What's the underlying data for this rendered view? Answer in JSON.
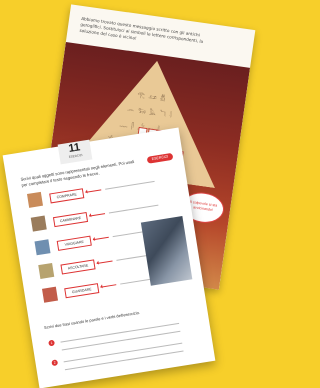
{
  "back_page": {
    "intro": "Abbiamo trovato questo messaggio scritto con gli antichi geroglifici. Sostituisci ai simboli le lettere corrispondenti, la soluzione del caso è vicina!",
    "bubble": "Il colpevole si sta avvicinando!"
  },
  "front_page": {
    "page_number": "11",
    "page_label": "ESERCIZI",
    "intro": "Scrivi quali oggetti sono rappresentati negli elementi. Poi usali per completare il testo seguendo le frecce.",
    "pill": "ESERCIZI",
    "items": [
      {
        "word": "COMPRARE"
      },
      {
        "word": "CAMMINARE"
      },
      {
        "word": "VIAGGIARE"
      },
      {
        "word": "ASCOLTARE"
      },
      {
        "word": "GUARDARE"
      }
    ],
    "bottom_text": "Scrivi due frasi usando le parole e i verbi dell'esercizio.",
    "bullets": [
      "1",
      "2"
    ]
  }
}
